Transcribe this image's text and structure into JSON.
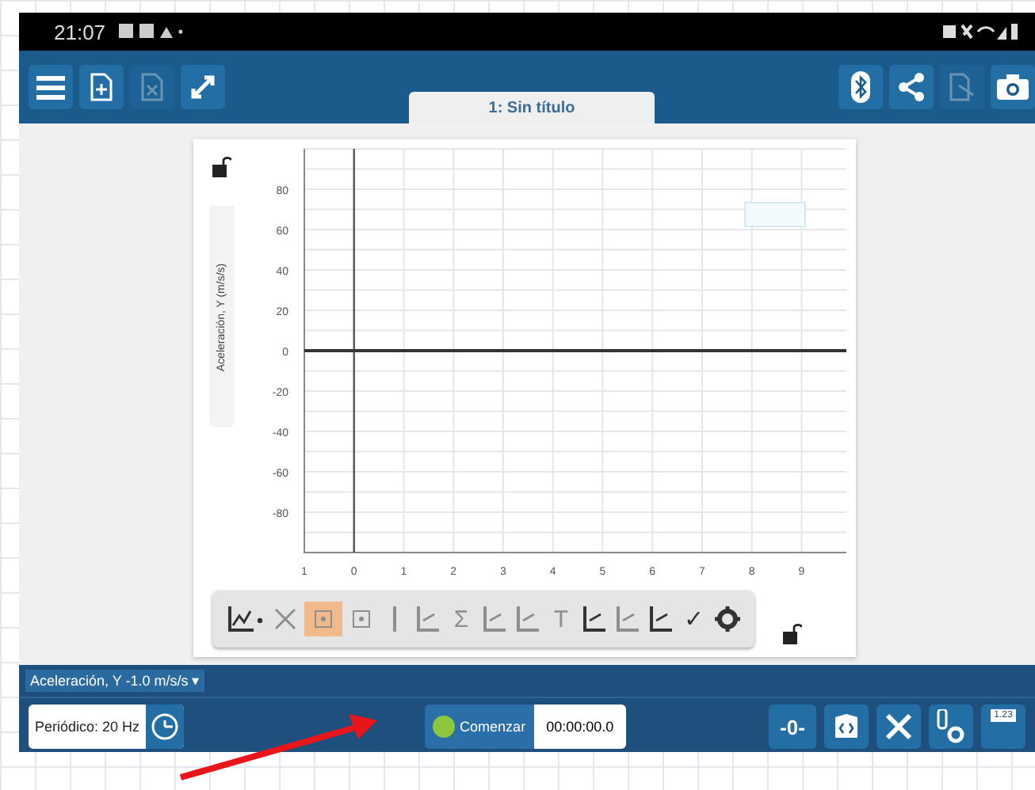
{
  "status_bar": {
    "time": "21:07"
  },
  "toolbar": {
    "left": [
      {
        "kind": "menu",
        "disabled": false
      },
      {
        "kind": "new-file",
        "disabled": false
      },
      {
        "kind": "delete-file",
        "disabled": true
      },
      {
        "kind": "expand",
        "disabled": false
      }
    ],
    "right": [
      {
        "kind": "bluetooth",
        "disabled": false
      },
      {
        "kind": "share",
        "disabled": false
      },
      {
        "kind": "export",
        "disabled": true
      },
      {
        "kind": "camera",
        "disabled": false
      }
    ]
  },
  "tabs": [
    {
      "label": "1: Sin título",
      "selected": true
    }
  ],
  "graph": {
    "chart_data": {
      "type": "line",
      "ylabel": "Aceleración, Y (m/s/s)",
      "grid": true,
      "xlim": [
        -1,
        9.9
      ],
      "ylim": [
        -100,
        100
      ],
      "xticks": [
        {
          "value": -1,
          "label": "1"
        },
        0,
        1,
        2,
        3,
        4,
        5,
        6,
        7,
        8,
        9
      ],
      "yticks": [
        80,
        60,
        40,
        20,
        0,
        -20,
        -40,
        -60,
        -80
      ]
    },
    "tools": [
      {
        "kind": "graph-type",
        "disabled": false,
        "selected": false
      },
      {
        "kind": "arrows",
        "disabled": true,
        "selected": false
      },
      {
        "kind": "box",
        "disabled": true,
        "selected": true
      },
      {
        "kind": "box",
        "disabled": true,
        "selected": false
      },
      {
        "kind": "line",
        "disabled": true,
        "selected": false
      },
      {
        "kind": "axes",
        "disabled": true,
        "selected": false
      },
      {
        "kind": "glyph",
        "glyph": "Σ",
        "disabled": true,
        "selected": false
      },
      {
        "kind": "axes",
        "disabled": true,
        "selected": false
      },
      {
        "kind": "axes",
        "disabled": true,
        "selected": false
      },
      {
        "kind": "glyph",
        "glyph": "T",
        "disabled": true,
        "selected": false
      },
      {
        "kind": "axes",
        "disabled": false,
        "selected": false
      },
      {
        "kind": "axes",
        "disabled": true,
        "selected": false
      },
      {
        "kind": "axes",
        "disabled": false,
        "selected": false
      },
      {
        "kind": "glyph",
        "glyph": "✓",
        "disabled": false,
        "selected": false
      },
      {
        "kind": "gear",
        "disabled": false,
        "selected": false
      }
    ]
  },
  "sensor_label": "Aceleración, Y -1.0 m/s/s ▾",
  "controls": {
    "rate": "Periódico: 20 Hz",
    "start": "Comenzar",
    "timer": "00:00:00.0",
    "zero": "-0-",
    "meter": "1.23"
  }
}
